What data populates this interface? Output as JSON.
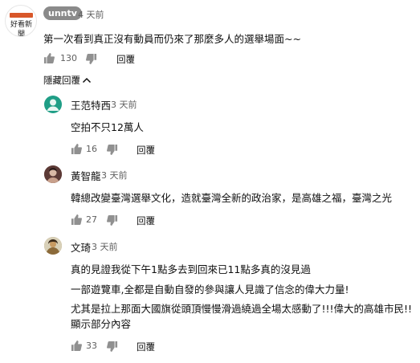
{
  "main_comment": {
    "channel": "unntv",
    "time": "4 天前",
    "avatar_text": "好看新聞",
    "text": "第一次看到真正沒有動員而仍來了那麼多人的選舉場面~~",
    "likes": "130",
    "reply_label": "回覆"
  },
  "hide_replies_label": "隱藏回覆",
  "replies": [
    {
      "author": "王范特西",
      "time": "3 天前",
      "lines": [
        "空拍不只12萬人"
      ],
      "likes": "16",
      "reply_label": "回覆",
      "avatar_color": "#1f9e86"
    },
    {
      "author": "黃智龍",
      "time": "3 天前",
      "lines": [
        "韓總改變臺灣選舉文化，造就臺灣全新的政治家，是高雄之福，臺灣之光"
      ],
      "likes": "27",
      "reply_label": "回覆",
      "avatar_color": "#7a4a45"
    },
    {
      "author": "文琦",
      "time": "3 天前",
      "lines": [
        "真的見證我從下午1點多去到回來已11點多真的沒見過",
        "一部遊覽車,全都是自動自發的參與讓人見識了信念的偉大力量!",
        "尤其是拉上那面大國旗從頭頂慢慢滑過繞過全場太感動了!!!偉大的高雄市民!!",
        "顯示部分內容"
      ],
      "likes": "33",
      "reply_label": "回覆",
      "avatar_color": "#a88a5a"
    }
  ]
}
